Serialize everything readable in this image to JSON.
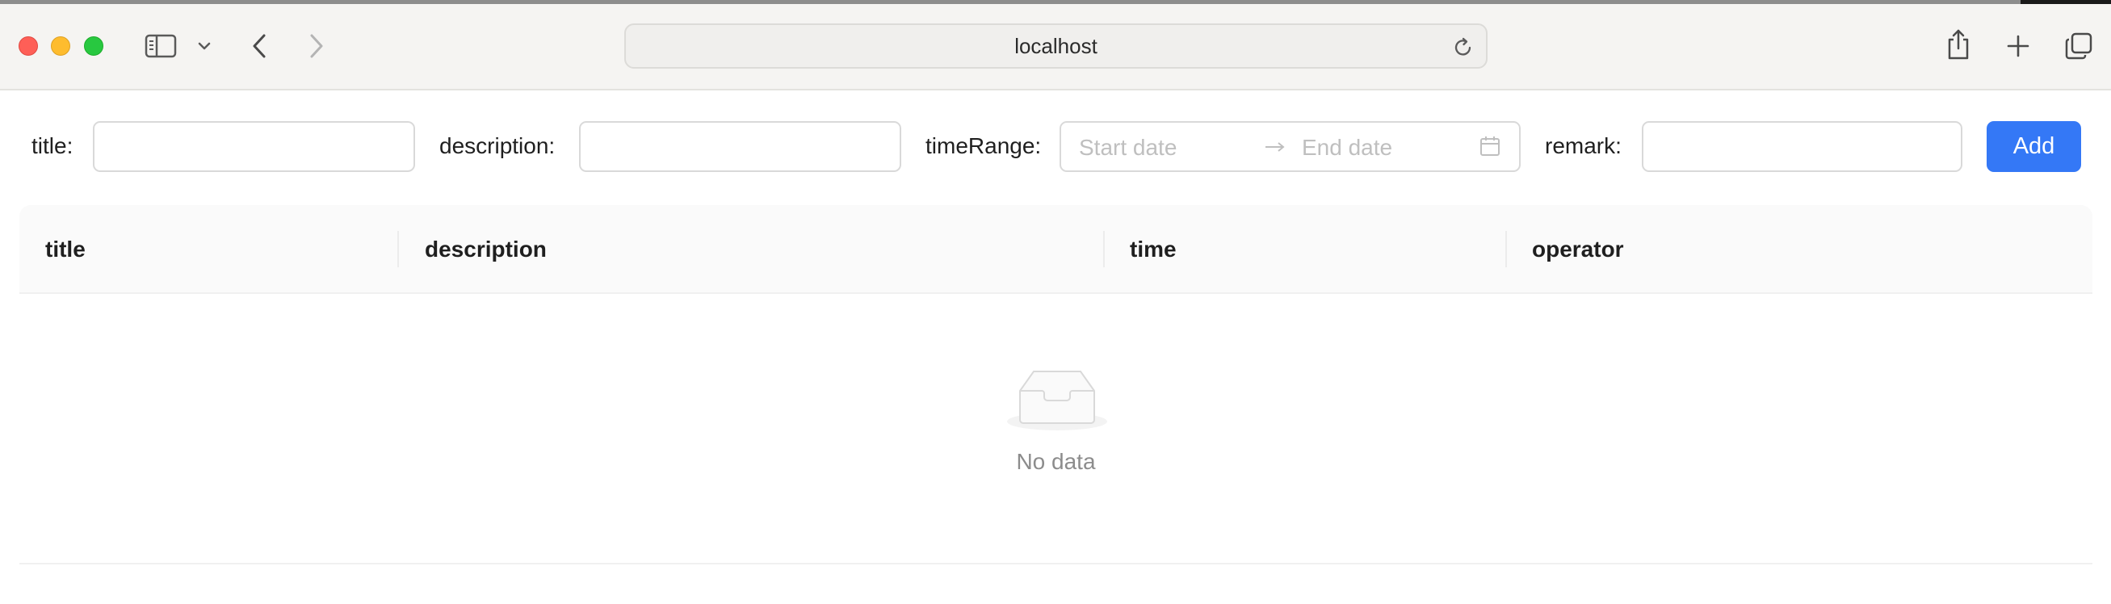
{
  "browser": {
    "url": "localhost",
    "icons": {
      "sidebar": "sidebar-icon",
      "tab_menu": "chevron-down-icon",
      "back": "back-arrow-icon",
      "forward": "forward-arrow-icon",
      "reload": "reload-icon",
      "share": "share-icon",
      "new_tab": "plus-icon",
      "tabs": "tab-overview-icon"
    }
  },
  "form": {
    "title_label": "title:",
    "title_value": "",
    "description_label": "description:",
    "description_value": "",
    "time_range_label": "timeRange:",
    "start_placeholder": "Start date",
    "end_placeholder": "End date",
    "remark_label": "remark:",
    "remark_value": "",
    "add_label": "Add"
  },
  "table": {
    "columns": [
      "title",
      "description",
      "time",
      "operator"
    ],
    "rows": [],
    "empty_text": "No data"
  },
  "colors": {
    "primary": "#3478f6",
    "header_bg": "#fafafa",
    "border": "#d9d9d9"
  }
}
